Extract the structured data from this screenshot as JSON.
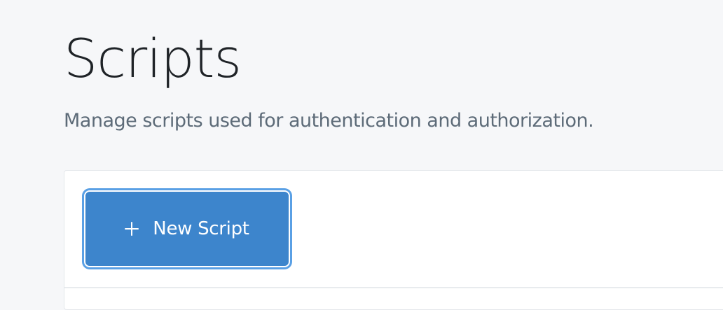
{
  "page": {
    "title": "Scripts",
    "description": "Manage scripts used for authentication and authorization."
  },
  "toolbar": {
    "new_script_label": "New Script",
    "new_script_icon": "plus-icon"
  },
  "colors": {
    "background": "#f6f7f9",
    "primary_button": "#3d85cc",
    "focus_ring": "#5aa0e5",
    "title_text": "#1f2327",
    "description_text": "#5d6b78"
  }
}
